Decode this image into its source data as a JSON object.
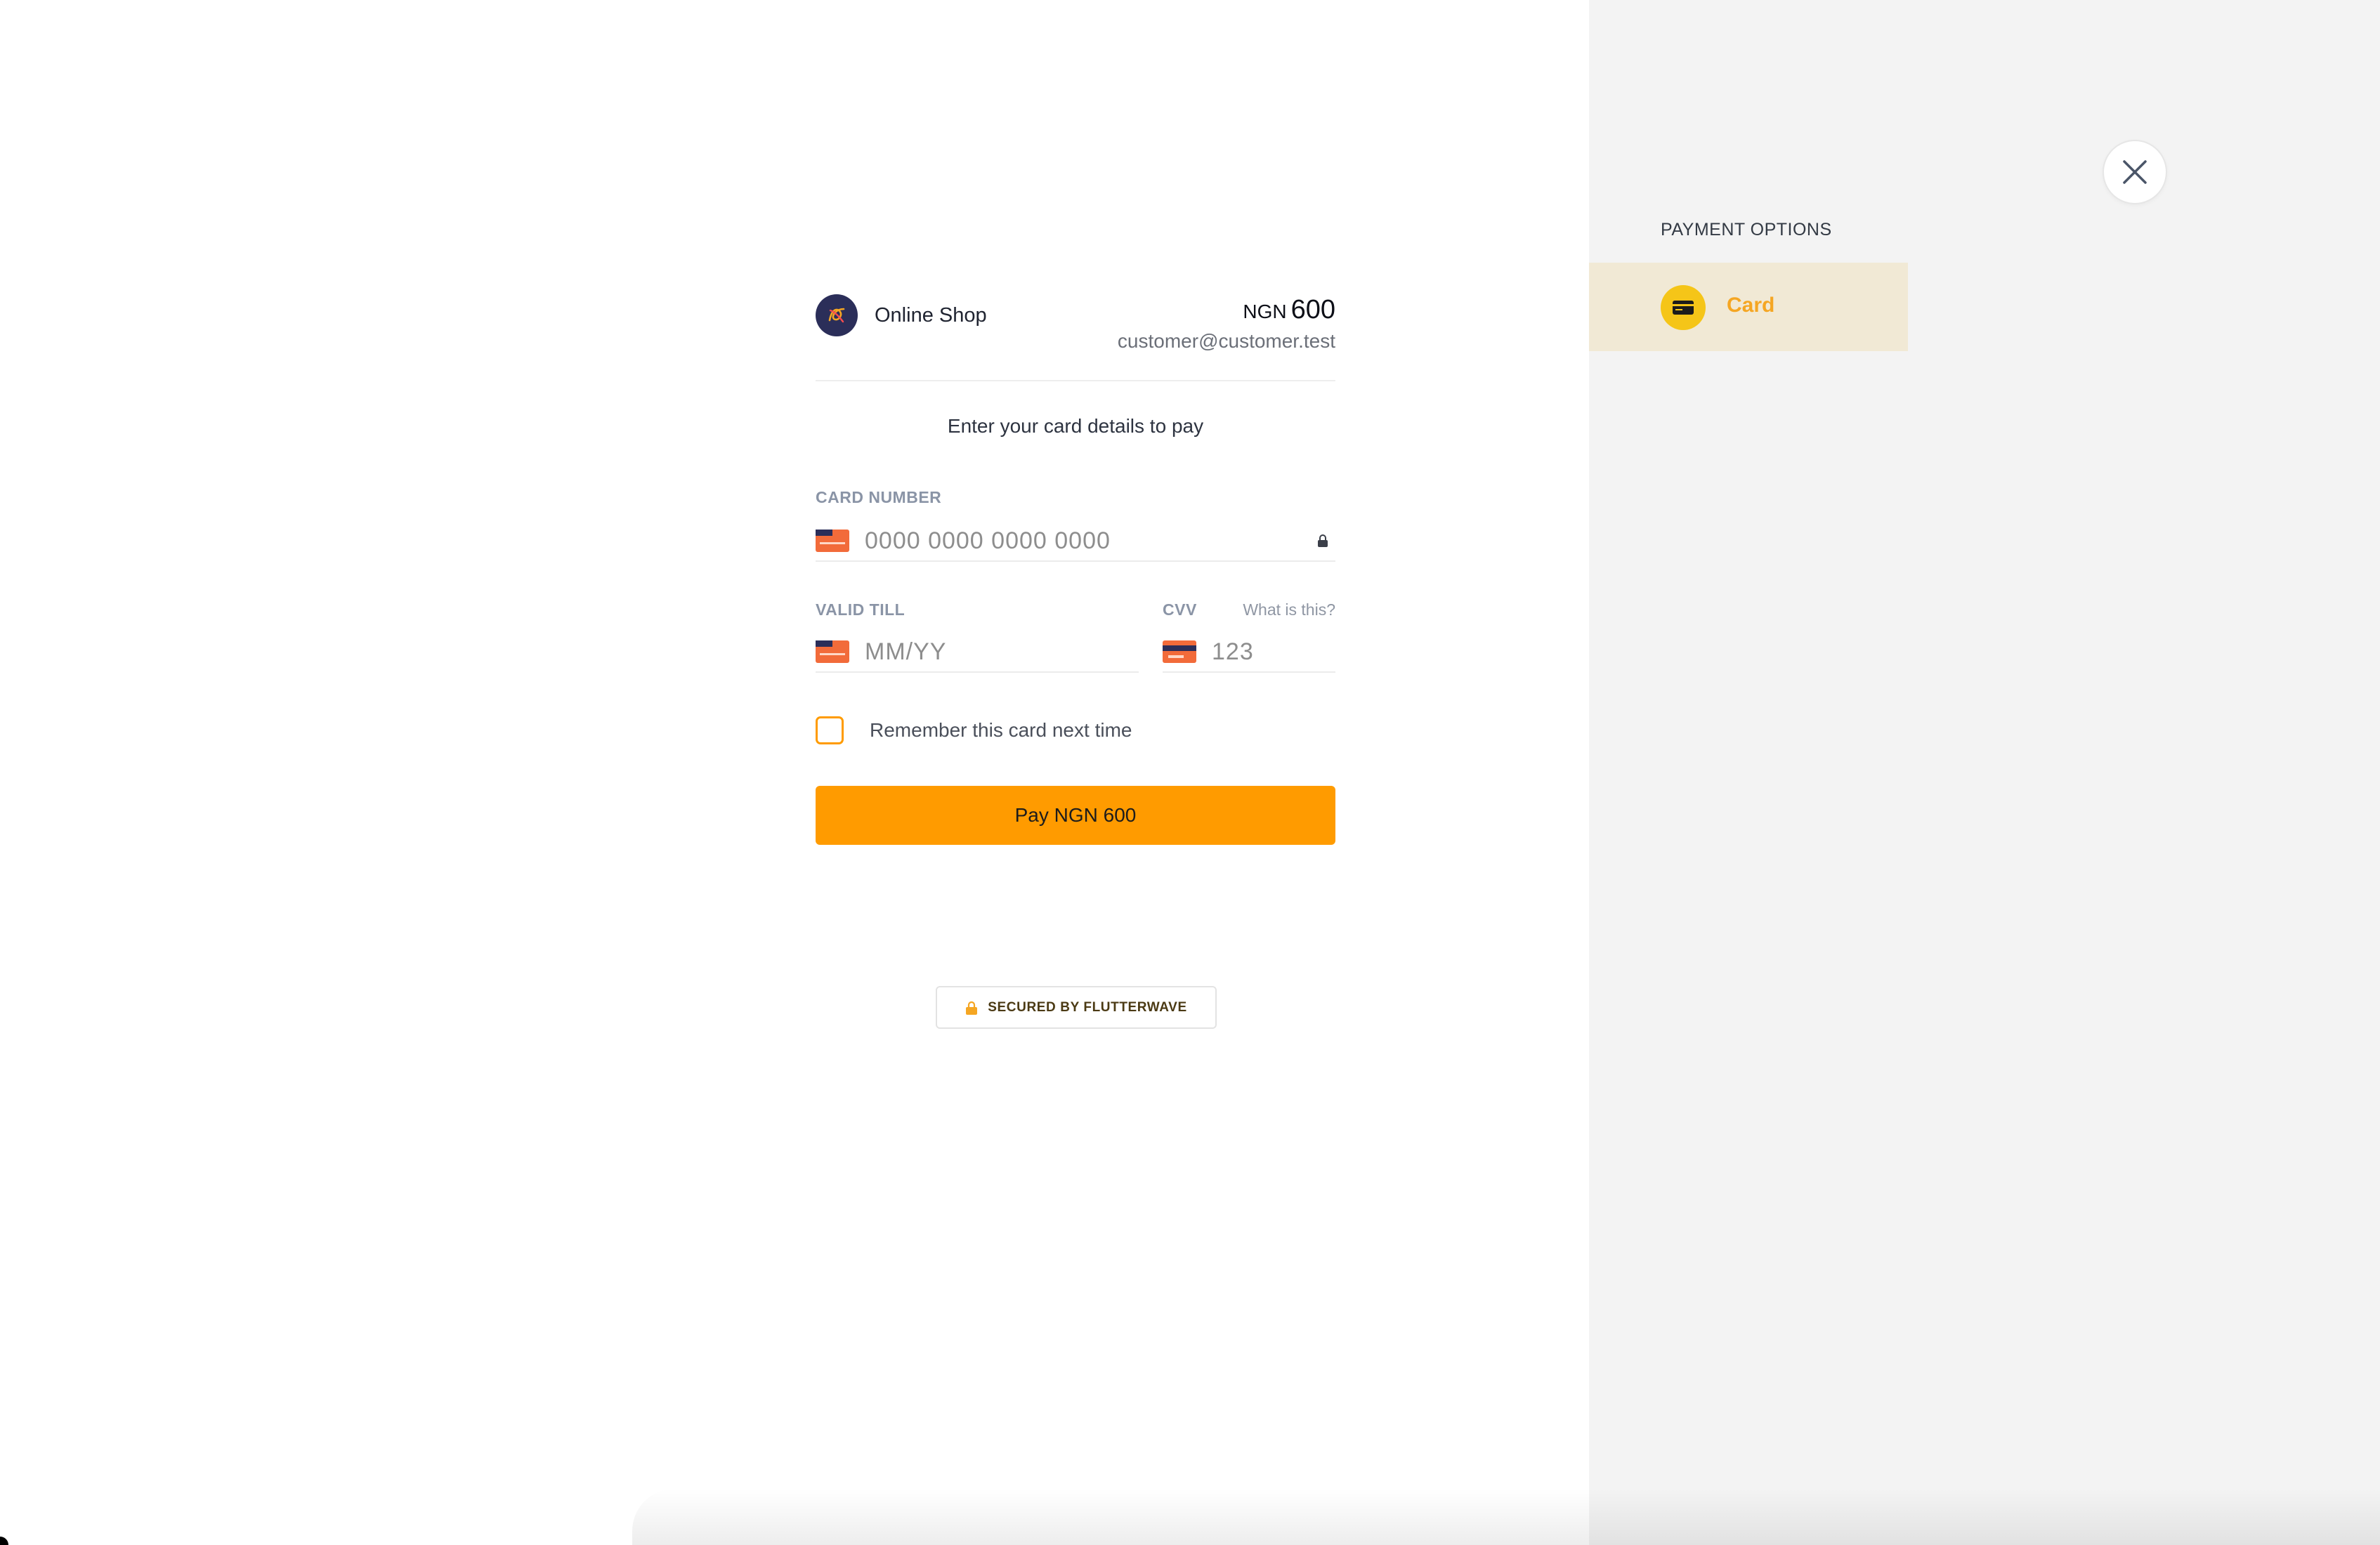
{
  "merchant": {
    "name": "Online Shop",
    "logo_icon": "flutterwave-knot-logo-icon"
  },
  "amount": {
    "currency": "NGN",
    "value": "600"
  },
  "customer": {
    "email": "customer@customer.test"
  },
  "instruction": "Enter your card details to pay",
  "card_form": {
    "card_number": {
      "label": "CARD NUMBER",
      "placeholder": "0000 0000 0000 0000",
      "value": "",
      "icon": "credit-card-icon",
      "trailing_icon": "lock-icon"
    },
    "valid_till": {
      "label": "VALID TILL",
      "placeholder": "MM/YY",
      "value": "",
      "icon": "credit-card-icon"
    },
    "cvv": {
      "label": "CVV",
      "hint": "What is this?",
      "placeholder": "123",
      "value": "",
      "icon": "card-back-icon"
    },
    "remember": {
      "label": "Remember this card next time",
      "checked": false
    },
    "pay_button_label": "Pay NGN 600"
  },
  "secured": {
    "text": "SECURED BY FLUTTERWAVE",
    "icon": "lock-icon"
  },
  "sidebar": {
    "title": "PAYMENT OPTIONS",
    "options": [
      {
        "label": "Card",
        "icon": "credit-card-icon",
        "selected": true
      }
    ],
    "close_icon": "close-icon"
  },
  "colors": {
    "accent": "#ff9b00",
    "selected_option_bg": "#f1e9d5",
    "selected_option_text": "#f5a623",
    "sidebar_bg": "#f3f3f3",
    "card_icon_orange": "#f26b3a",
    "card_icon_navy": "#2b2e59"
  }
}
